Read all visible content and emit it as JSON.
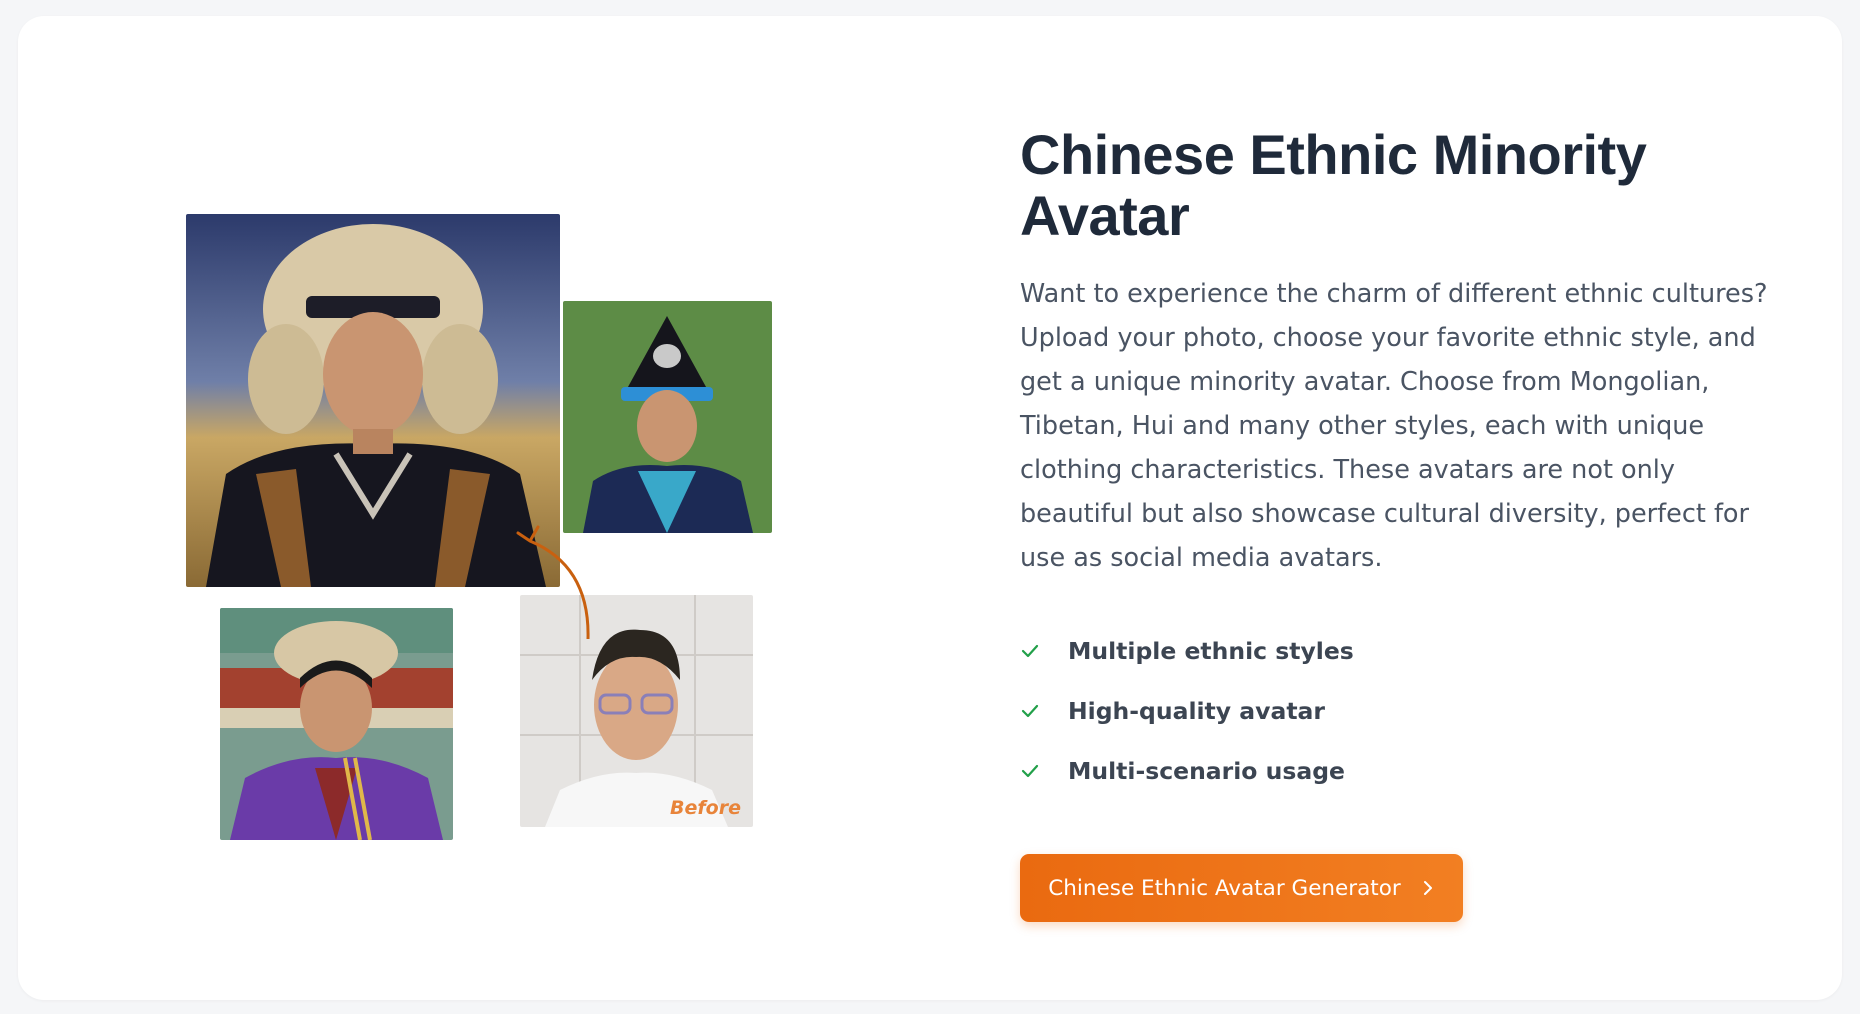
{
  "section": {
    "title": "Chinese Ethnic Minority Avatar",
    "description": "Want to experience the charm of different ethnic cultures? Upload your photo, choose your favorite ethnic style, and get a unique minority avatar. Choose from Mongolian, Tibetan, Hui and many other styles, each with unique clothing characteristics. These avatars are not only beautiful but also showcase cultural diversity, perfect for use as social media avatars.",
    "features": [
      {
        "label": "Multiple ethnic styles",
        "icon": "check-icon"
      },
      {
        "label": "High-quality avatar",
        "icon": "check-icon"
      },
      {
        "label": "Multi-scenario usage",
        "icon": "check-icon"
      }
    ],
    "cta": {
      "label": "Chinese Ethnic Avatar Generator",
      "icon": "chevron-right-icon"
    }
  },
  "gallery": {
    "before_label": "Before",
    "arrow_icon": "curved-arrow-icon"
  },
  "colors": {
    "accent": "#ea6a10",
    "check": "#22a04a",
    "title": "#1f2a3a",
    "body_text": "#4a5463"
  }
}
